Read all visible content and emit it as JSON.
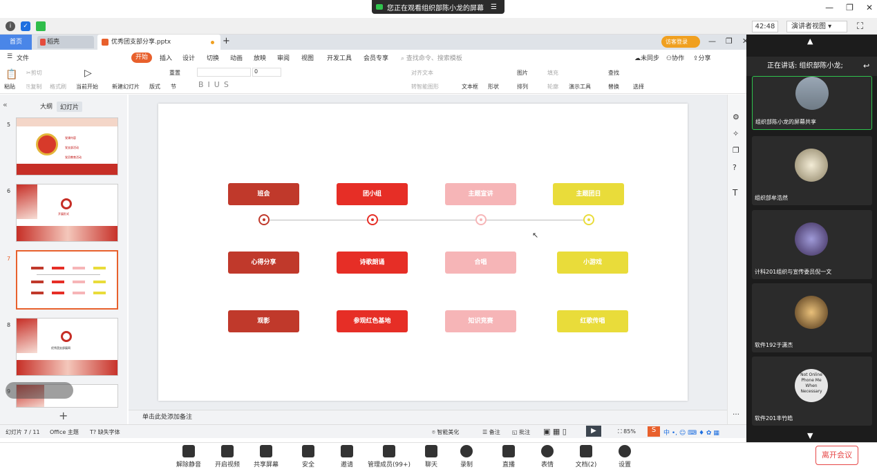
{
  "share_banner": {
    "text": "您正在观看组织部陈小龙的屏幕"
  },
  "meeting_toolbar": {
    "timer": "42:48",
    "presenter_view": "演讲者视图"
  },
  "wps": {
    "tabs": {
      "home": "首页",
      "wenke": "稻壳",
      "doc": "优秀团支部分享.pptx",
      "login": "访客登录"
    },
    "menu": [
      "文件",
      "开始",
      "插入",
      "设计",
      "切换",
      "动画",
      "放映",
      "审阅",
      "视图",
      "开发工具",
      "会员专享"
    ],
    "search_placeholder": "查找命令、搜索模板",
    "sync": "未同步",
    "collab": "协作",
    "share": "分享",
    "ribbon": {
      "paste": "粘贴",
      "cut": "剪切",
      "copy": "复制",
      "format_painter": "格式刷",
      "play_from": "当前开始",
      "new_slide": "新建幻灯片",
      "layout": "版式",
      "section": "节",
      "reset": "重置",
      "font_size": "0",
      "text_box": "文本框",
      "shape": "形状",
      "picture": "图片",
      "fill": "填充",
      "arrange": "排列",
      "outline": "轮廓",
      "present_tool": "演示工具",
      "find": "查找",
      "replace": "替换",
      "select": "选择",
      "align_text": "对齐文本",
      "convert_smart": "转智能图形"
    },
    "panel_tabs": [
      "大纲",
      "幻灯片"
    ],
    "thumb_nums": [
      "5",
      "6",
      "7",
      "8",
      "9"
    ],
    "thumb_texts": {
      "t5": [
        "党课内容",
        "党支部活动",
        "党员教育活动"
      ],
      "t6": "开展形式",
      "t8": "优秀团支部展网"
    },
    "slide": {
      "row1": [
        "班会",
        "团小组",
        "主题宣讲",
        "主题团日"
      ],
      "row2": [
        "心得分享",
        "诗歌朗诵",
        "合唱",
        "小游戏"
      ],
      "row3": [
        "观影",
        "参观红色基地",
        "知识竞赛",
        "红歌传唱"
      ],
      "colors": [
        "#c0392b",
        "#e62e26",
        "#f6b5b7",
        "#e9dc3a"
      ]
    },
    "notes_placeholder": "单击此处添加备注",
    "status": {
      "slide_info": "幻灯片 7 / 11",
      "theme": "Office 主题",
      "missing_font": "缺失字体",
      "beautify": "智能美化",
      "notes": "备注",
      "comments": "批注",
      "zoom": "85%"
    }
  },
  "meeting": {
    "speaking": "正在讲话: 组织部陈小龙;",
    "tiles": [
      "组织部陈小龙的屏幕共享",
      "组织部牟浩然",
      "计科201组织与宣传委员倪一文",
      "软件192于潇杰",
      "软件201丰竹皓"
    ],
    "tile4_text": [
      "Not Online",
      "Phone Me",
      "When",
      "Necessary"
    ],
    "buttons": [
      "解除静音",
      "开启视频",
      "共享屏幕",
      "安全",
      "邀请",
      "管理成员(99+)",
      "聊天",
      "录制",
      "直播",
      "表情",
      "文档(2)",
      "设置"
    ],
    "leave": "离开会议"
  }
}
